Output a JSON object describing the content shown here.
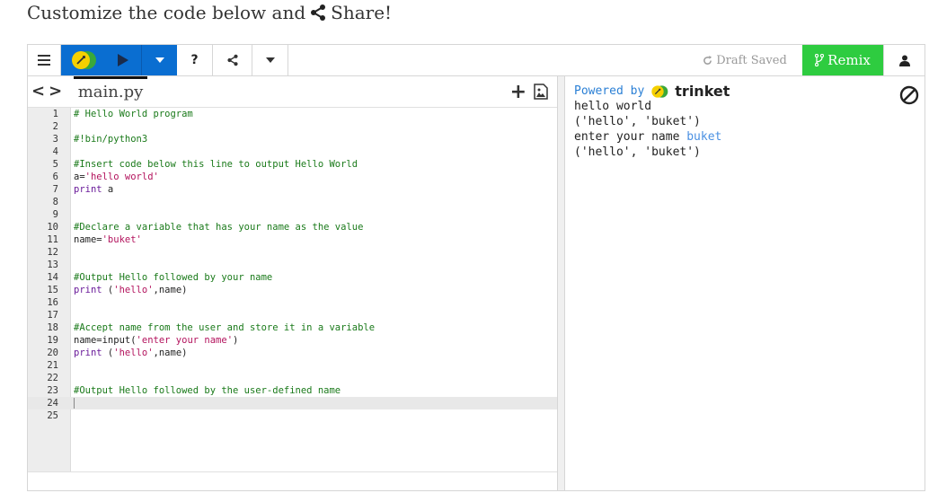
{
  "intro": {
    "text_before": "Customize the code below and",
    "share_word": "Share!"
  },
  "toolbar": {
    "menu_icon": "hamburger-icon",
    "logo_icon": "trinket-logo-icon",
    "run_icon": "play-icon",
    "run_dropdown_icon": "caret-down-icon",
    "help_label": "?",
    "share_icon": "share-icon",
    "more_icon": "caret-down-icon",
    "draft_label": "Draft Saved",
    "remix_label": "Remix",
    "user_icon": "user-icon"
  },
  "editor": {
    "nav_label": "<>",
    "file_tab": "main.py",
    "add_label": "+",
    "lines": [
      {
        "n": "1",
        "segs": [
          {
            "t": "# Hello World program",
            "c": "c-comment"
          }
        ]
      },
      {
        "n": "2",
        "segs": []
      },
      {
        "n": "3",
        "segs": [
          {
            "t": "#!bin/python3",
            "c": "c-comment"
          }
        ]
      },
      {
        "n": "4",
        "segs": []
      },
      {
        "n": "5",
        "segs": [
          {
            "t": "#Insert code below this line to output Hello World",
            "c": "c-comment"
          }
        ]
      },
      {
        "n": "6",
        "segs": [
          {
            "t": "a=",
            "c": "c-plain"
          },
          {
            "t": "'hello world'",
            "c": "c-str"
          }
        ]
      },
      {
        "n": "7",
        "segs": [
          {
            "t": "print",
            "c": "c-kw"
          },
          {
            "t": " a",
            "c": "c-plain"
          }
        ]
      },
      {
        "n": "8",
        "segs": []
      },
      {
        "n": "9",
        "segs": []
      },
      {
        "n": "10",
        "segs": [
          {
            "t": "#Declare a variable that has your name as the value",
            "c": "c-comment"
          }
        ]
      },
      {
        "n": "11",
        "segs": [
          {
            "t": "name=",
            "c": "c-plain"
          },
          {
            "t": "'buket'",
            "c": "c-str"
          }
        ]
      },
      {
        "n": "12",
        "segs": []
      },
      {
        "n": "13",
        "segs": []
      },
      {
        "n": "14",
        "segs": [
          {
            "t": "#Output Hello followed by your name",
            "c": "c-comment"
          }
        ]
      },
      {
        "n": "15",
        "segs": [
          {
            "t": "print",
            "c": "c-kw"
          },
          {
            "t": " (",
            "c": "c-plain"
          },
          {
            "t": "'hello'",
            "c": "c-str"
          },
          {
            "t": ",name)",
            "c": "c-plain"
          }
        ]
      },
      {
        "n": "16",
        "segs": []
      },
      {
        "n": "17",
        "segs": []
      },
      {
        "n": "18",
        "segs": [
          {
            "t": "#Accept name from the user and store it in a variable",
            "c": "c-comment"
          }
        ]
      },
      {
        "n": "19",
        "segs": [
          {
            "t": "name=input(",
            "c": "c-plain"
          },
          {
            "t": "'enter your name'",
            "c": "c-str"
          },
          {
            "t": ")",
            "c": "c-plain"
          }
        ]
      },
      {
        "n": "20",
        "segs": [
          {
            "t": "print",
            "c": "c-kw"
          },
          {
            "t": " (",
            "c": "c-plain"
          },
          {
            "t": "'hello'",
            "c": "c-str"
          },
          {
            "t": ",name)",
            "c": "c-plain"
          }
        ]
      },
      {
        "n": "21",
        "segs": []
      },
      {
        "n": "22",
        "segs": []
      },
      {
        "n": "23",
        "segs": [
          {
            "t": "#Output Hello followed by the user-defined name",
            "c": "c-comment"
          }
        ]
      },
      {
        "n": "24",
        "segs": [],
        "active": true,
        "cursor": true
      },
      {
        "n": "25",
        "segs": []
      }
    ]
  },
  "output": {
    "powered_by": "Powered by",
    "brand": "trinket",
    "lines": [
      {
        "text": "hello world"
      },
      {
        "text": "('hello', 'buket')"
      },
      {
        "text": "enter your name ",
        "input": "buket"
      },
      {
        "text": "('hello', 'buket')"
      }
    ]
  }
}
